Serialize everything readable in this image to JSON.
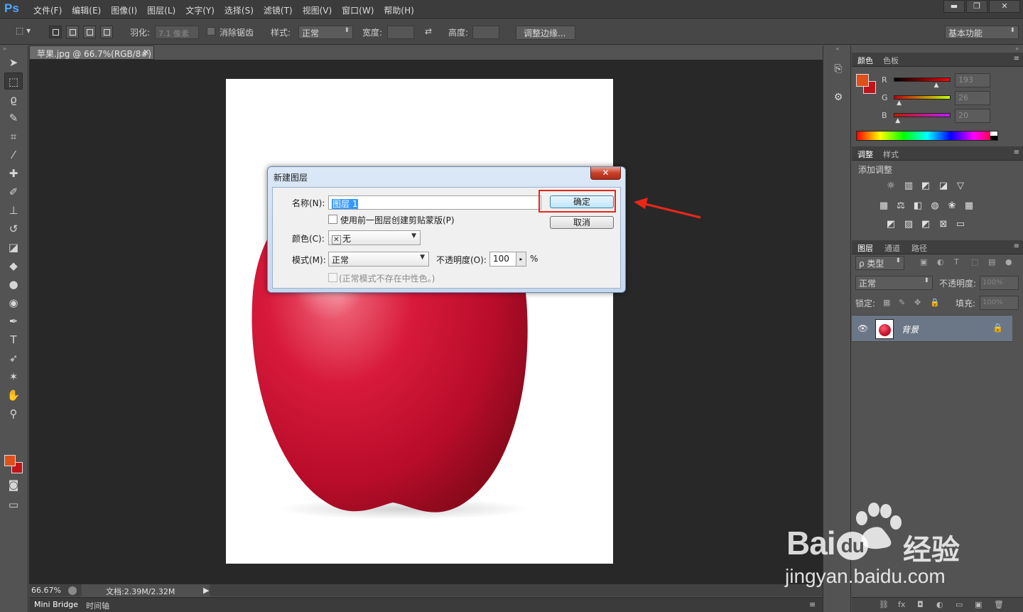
{
  "app": {
    "logo": "Ps"
  },
  "menu": [
    "文件(F)",
    "编辑(E)",
    "图像(I)",
    "图层(L)",
    "文字(Y)",
    "选择(S)",
    "滤镜(T)",
    "视图(V)",
    "窗口(W)",
    "帮助(H)"
  ],
  "window_controls": {
    "minimize": "▬",
    "restore": "❐",
    "close": "✕"
  },
  "options": {
    "feather_label": "羽化:",
    "feather_value": "7.1 像素",
    "antialias_label": "消除锯齿",
    "style_label": "样式:",
    "style_value": "正常",
    "width_label": "宽度:",
    "height_label": "高度:",
    "refine_edge": "调整边缘...",
    "workspace": "基本功能"
  },
  "document": {
    "tab": "苹果.jpg @ 66.7%(RGB/8#)",
    "close": "×"
  },
  "status": {
    "zoom": "66.67%",
    "docinfo": "文档:2.39M/2.32M",
    "arrow": "▶"
  },
  "bottom_tabs": [
    "Mini Bridge",
    "时间轴"
  ],
  "color_panel": {
    "tabs": [
      "颜色",
      "色板"
    ],
    "channels": [
      {
        "label": "R",
        "value": "193",
        "level": 0.757,
        "grad": "linear-gradient(to right,#000,#ff0000)"
      },
      {
        "label": "G",
        "value": "26",
        "level": 0.102,
        "grad": "linear-gradient(to right,#c10000,#c1ff00)"
      },
      {
        "label": "B",
        "value": "20",
        "level": 0.078,
        "grad": "linear-gradient(to right,#c11a00,#c11aff)"
      }
    ],
    "fg": "#e0501a",
    "bg": "#c1141a"
  },
  "adjust_panel": {
    "tabs": [
      "调整",
      "样式"
    ],
    "add_label": "添加调整"
  },
  "layers_panel": {
    "tabs": [
      "图层",
      "通道",
      "路径"
    ],
    "filter_kind": "ρ 类型",
    "blend_mode": "正常",
    "opacity_label": "不透明度:",
    "opacity_value": "100%",
    "lock_label": "锁定:",
    "fill_label": "填充:",
    "fill_value": "100%",
    "layer_name": "背景",
    "footer_icons": [
      "⛓",
      "fx",
      "◘",
      "◐",
      "▭",
      "▣",
      "🗑"
    ]
  },
  "dialog": {
    "title": "新建图层",
    "close": "✕",
    "name_label": "名称(N):",
    "name_value": "图层 1",
    "use_prev_label": "使用前一图层创建剪贴蒙版(P)",
    "color_label": "颜色(C):",
    "color_value": "无",
    "mode_label": "模式(M):",
    "mode_value": "正常",
    "opacity_label": "不透明度(O):",
    "opacity_value": "100",
    "percent": "%",
    "neutral_label": "(正常模式不存在中性色。)",
    "ok": "确定",
    "cancel": "取消"
  },
  "watermark": {
    "brand": "Bai",
    "brand2": "du",
    "product": "经验",
    "url": "jingyan.baidu.com"
  },
  "colors": {
    "highlight": "#e8271a",
    "accent": "#4fa7ff"
  }
}
